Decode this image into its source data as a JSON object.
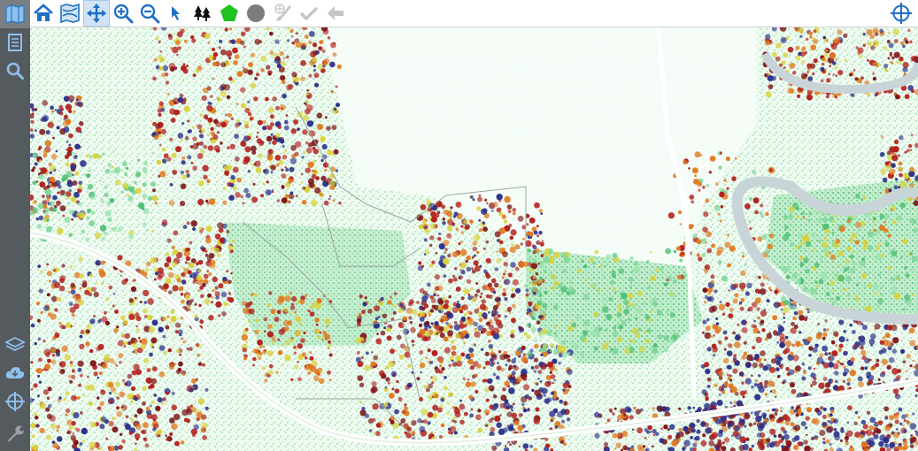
{
  "sidebar": {
    "top_items": [
      {
        "name": "map-icon",
        "active": true
      },
      {
        "name": "document-icon",
        "active": false
      },
      {
        "name": "search-icon",
        "active": false
      }
    ],
    "bottom_items": [
      {
        "name": "layers-icon"
      },
      {
        "name": "cloud-icon"
      },
      {
        "name": "crosshair-icon"
      },
      {
        "name": "wrench-icon"
      }
    ]
  },
  "toolbar": {
    "tools": [
      {
        "name": "home-icon",
        "active": false,
        "disabled": false
      },
      {
        "name": "full-extent-map-icon",
        "active": false,
        "disabled": false
      },
      {
        "name": "pan-icon",
        "active": true,
        "disabled": false
      },
      {
        "name": "zoom-in-icon",
        "active": false,
        "disabled": false
      },
      {
        "name": "zoom-out-icon",
        "active": false,
        "disabled": false
      },
      {
        "name": "select-pointer-icon",
        "active": false,
        "disabled": false
      },
      {
        "name": "tree-icon",
        "active": false,
        "disabled": false
      },
      {
        "name": "polygon-icon",
        "active": false,
        "disabled": false
      },
      {
        "name": "circle-icon",
        "active": false,
        "disabled": false
      },
      {
        "name": "brush-icon",
        "active": false,
        "disabled": true
      },
      {
        "name": "check-icon",
        "active": false,
        "disabled": true
      },
      {
        "name": "back-arrow-icon",
        "active": false,
        "disabled": true
      }
    ],
    "right_tool": {
      "name": "locate-crosshair-icon"
    }
  },
  "colors": {
    "sidebar_bg": "#555a5f",
    "icon_blue": "#1f6fc2",
    "polygon_green": "#1fc21f",
    "circle_gray": "#7d7d7d",
    "canopy_red": "#b3201d",
    "canopy_darkred": "#7d1418",
    "canopy_orange": "#e07a20",
    "canopy_yellow": "#d8d23a",
    "canopy_blue": "#2b2f8a",
    "ground_green": "#7ed69a",
    "ground_light": "#e8f8ec",
    "road": "#ffffff",
    "river": "#c9d4d8"
  }
}
